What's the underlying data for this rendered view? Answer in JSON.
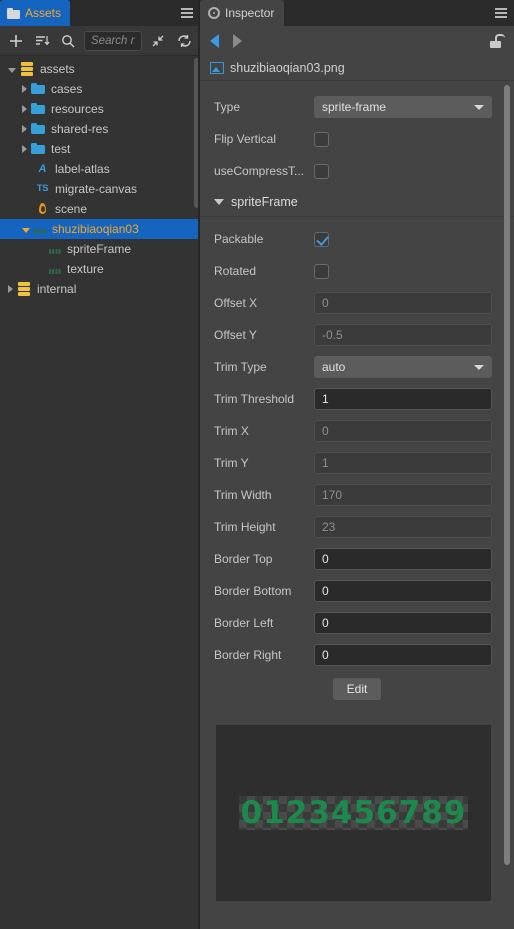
{
  "assets_panel": {
    "tab": {
      "label": "Assets",
      "icon": "folder-icon"
    },
    "menu_icon": "hamburger-icon",
    "toolbar": {
      "add_icon": "plus-icon",
      "sort_icon": "sort-icon",
      "search_icon": "search-icon",
      "collapse_icon": "collapse-all-icon",
      "refresh_icon": "refresh-icon",
      "search_placeholder": "Search n",
      "search_value": ""
    },
    "tree": [
      {
        "label": "assets",
        "icon": "database-icon",
        "indent": 0,
        "twisty": "open",
        "selected": false
      },
      {
        "label": "cases",
        "icon": "folder-icon",
        "indent": 1,
        "twisty": "closed",
        "selected": false
      },
      {
        "label": "resources",
        "icon": "folder-icon",
        "indent": 1,
        "twisty": "closed",
        "selected": false
      },
      {
        "label": "shared-res",
        "icon": "folder-icon",
        "indent": 1,
        "twisty": "closed",
        "selected": false
      },
      {
        "label": "test",
        "icon": "folder-icon",
        "indent": 1,
        "twisty": "closed",
        "selected": false
      },
      {
        "label": "label-atlas",
        "icon": "label-atlas-icon",
        "indent": 1,
        "twisty": "none",
        "selected": false
      },
      {
        "label": "migrate-canvas",
        "icon": "typescript-icon",
        "indent": 1,
        "twisty": "none",
        "selected": false
      },
      {
        "label": "scene",
        "icon": "scene-flame-icon",
        "indent": 1,
        "twisty": "none",
        "selected": false
      },
      {
        "label": "shuzibiaoqian03",
        "icon": "image-dash-icon",
        "indent": 1,
        "twisty": "open",
        "selected": true
      },
      {
        "label": "spriteFrame",
        "icon": "sprite-frame-icon",
        "indent": 2,
        "twisty": "none",
        "selected": false
      },
      {
        "label": "texture",
        "icon": "texture-icon",
        "indent": 2,
        "twisty": "none",
        "selected": false
      },
      {
        "label": "internal",
        "icon": "database-icon",
        "indent": 0,
        "twisty": "closed",
        "selected": false
      }
    ]
  },
  "inspector": {
    "tab": {
      "label": "Inspector",
      "icon": "gear-icon"
    },
    "menu_icon": "hamburger-icon",
    "nav": {
      "back_icon": "arrow-back-icon",
      "forward_icon": "arrow-forward-icon",
      "lock_icon": "lock-open-icon"
    },
    "file": {
      "name": "shuzibiaoqian03.png",
      "icon": "image-file-icon"
    },
    "top_props": [
      {
        "label": "Type",
        "kind": "select",
        "value": "sprite-frame"
      },
      {
        "label": "Flip Vertical",
        "kind": "checkbox",
        "checked": false
      },
      {
        "label": "useCompressT...",
        "kind": "checkbox",
        "checked": false
      }
    ],
    "section": {
      "label": "spriteFrame",
      "expanded": true
    },
    "props": [
      {
        "label": "Trim Threshold",
        "kind": "text",
        "value": "1",
        "active": true
      },
      {
        "label": "Trim X",
        "kind": "text",
        "value": "0",
        "active": false
      },
      {
        "label": "Trim Y",
        "kind": "text",
        "value": "1",
        "active": false
      },
      {
        "label": "Trim Width",
        "kind": "text",
        "value": "170",
        "active": false
      },
      {
        "label": "Trim Height",
        "kind": "text",
        "value": "23",
        "active": false
      },
      {
        "label": "Border Top",
        "kind": "text",
        "value": "0",
        "active": true
      },
      {
        "label": "Border Bottom",
        "kind": "text",
        "value": "0",
        "active": true
      },
      {
        "label": "Border Left",
        "kind": "text",
        "value": "0",
        "active": true
      },
      {
        "label": "Border Right",
        "kind": "text",
        "value": "0",
        "active": true
      }
    ],
    "sprite_props": [
      {
        "label": "Packable",
        "kind": "checkbox",
        "checked": true
      },
      {
        "label": "Rotated",
        "kind": "checkbox",
        "checked": false
      },
      {
        "label": "Offset X",
        "kind": "text",
        "value": "0",
        "active": false
      },
      {
        "label": "Offset Y",
        "kind": "text",
        "value": "-0.5",
        "active": false
      },
      {
        "label": "Trim Type",
        "kind": "select",
        "value": "auto"
      }
    ],
    "edit_button": "Edit",
    "preview": {
      "sprite_text": "0123456789",
      "sprite_color": "#1c8a4d",
      "name": "sprite-preview"
    }
  },
  "colors": {
    "selection_blue": "#1565c0",
    "selection_text": "#f5a623",
    "panel_bg": "#444444",
    "tree_bg": "#333333",
    "accent_blue": "#3b9ae1"
  }
}
